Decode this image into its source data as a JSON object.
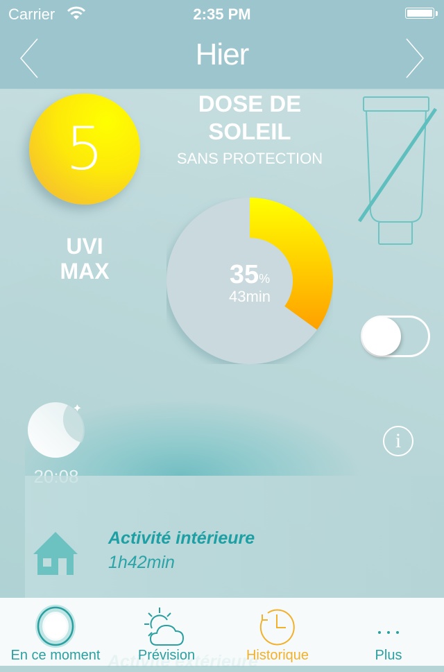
{
  "status_bar": {
    "carrier": "Carrier",
    "time": "2:35 PM"
  },
  "nav": {
    "title": "Hier",
    "prev_icon": "chevron-left-icon",
    "next_icon": "chevron-right-icon"
  },
  "uvi": {
    "value": "5",
    "label_line1": "UVI",
    "label_line2": "MAX"
  },
  "dose": {
    "title_line1": "DOSE DE",
    "title_line2": "SOLEIL",
    "subtitle": "SANS PROTECTION",
    "percent": "35",
    "percent_unit": "%",
    "percent_value": 35,
    "minutes": "43min"
  },
  "sunscreen_toggle": {
    "on": false
  },
  "night": {
    "time": "20:08"
  },
  "activity": {
    "title": "Activité intérieure",
    "duration": "1h42min",
    "next_title_partial": "Activité extérieure"
  },
  "tabs": [
    {
      "label": "En ce moment",
      "icon": "now-ring-icon",
      "active": false
    },
    {
      "label": "Prévision",
      "icon": "sun-cloud-icon",
      "active": false
    },
    {
      "label": "Historique",
      "icon": "history-clock-icon",
      "active": true
    },
    {
      "label": "Plus",
      "icon": "more-dots-icon",
      "active": false
    }
  ],
  "colors": {
    "teal": "#2b9fa0",
    "orange": "#f2b12c",
    "yellow": "#ffff00",
    "header": "#9cc5cd"
  }
}
